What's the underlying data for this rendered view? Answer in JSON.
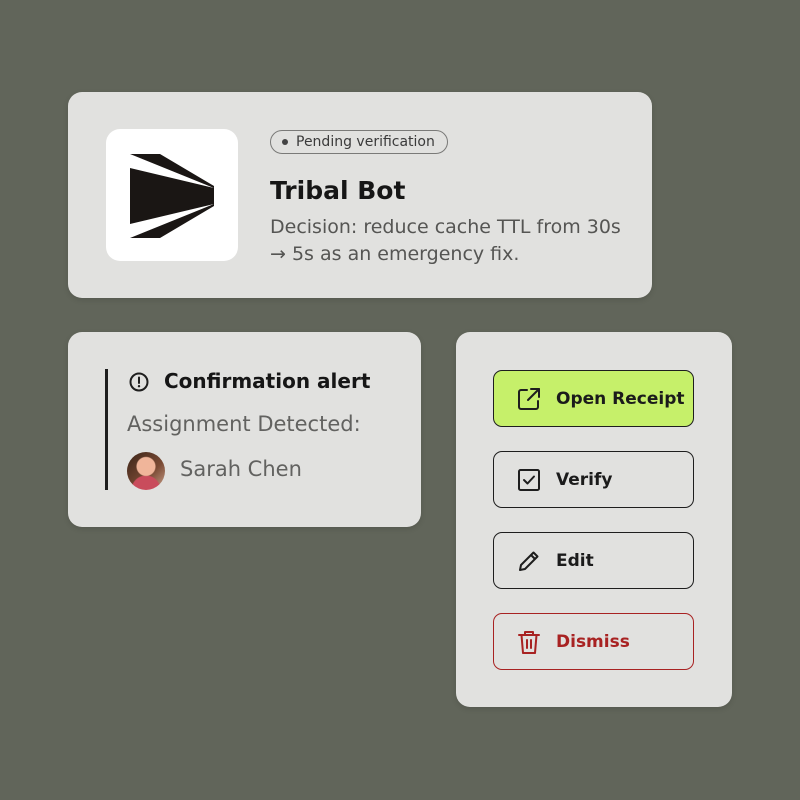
{
  "bot": {
    "status_badge": "Pending verification",
    "name": "Tribal Bot",
    "description": "Decision: reduce cache TTL from 30s → 5s as an emergency fix.",
    "logo_icon": "tribal-logo-icon"
  },
  "alert": {
    "title": "Confirmation alert",
    "icon": "alert-circle-icon",
    "subtitle": "Assignment Detected:",
    "assignee": "Sarah Chen"
  },
  "actions": {
    "open_receipt": {
      "label": "Open Receipt",
      "icon": "external-link-icon"
    },
    "verify": {
      "label": "Verify",
      "icon": "checkbox-icon"
    },
    "edit": {
      "label": "Edit",
      "icon": "pencil-icon"
    },
    "dismiss": {
      "label": "Dismiss",
      "icon": "trash-icon"
    }
  },
  "colors": {
    "background": "#61655a",
    "card": "#e1e1df",
    "primary_button": "#c6f06a",
    "danger": "#a82222"
  }
}
